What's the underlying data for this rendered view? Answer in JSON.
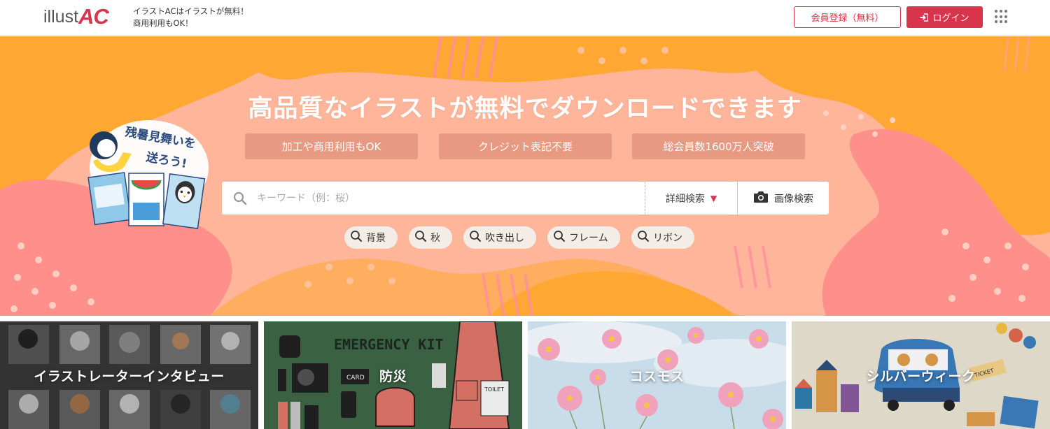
{
  "header": {
    "logo_text_1": "illust",
    "logo_text_2": "AC",
    "tagline_line1": "イラストACはイラストが無料！",
    "tagline_line2": "商用利用もOK！",
    "register_label": "会員登録（無料）",
    "login_label": "ログイン"
  },
  "hero": {
    "title": "高品質なイラストが無料でダウンロードできます",
    "features": [
      "加工や商用利用もOK",
      "クレジット表記不要",
      "総会員数1600万人突破"
    ],
    "search": {
      "placeholder": "キーワード（例：桜）",
      "value": "",
      "detail_label": "詳細検索",
      "image_search_label": "画像検索"
    },
    "tags": [
      "背景",
      "秋",
      "吹き出し",
      "フレーム",
      "リボン"
    ],
    "promo": {
      "line1": "残暑見舞いを",
      "line2": "送ろう!"
    }
  },
  "categories": [
    {
      "label": "イラストレーターインタビュー"
    },
    {
      "label": "防災"
    },
    {
      "label": "コスモス"
    },
    {
      "label": "シルバーウィーク"
    }
  ],
  "tile_texts": {
    "emergency_kit": "EMERGENCY KIT",
    "card": "CARD",
    "toilet": "TOILET",
    "ticket": "TICKET"
  },
  "colors": {
    "brand": "#d8344b",
    "hero_orange": "#ffa733",
    "hero_pink": "#ff8c8c",
    "hero_peach": "#ffb59a"
  }
}
